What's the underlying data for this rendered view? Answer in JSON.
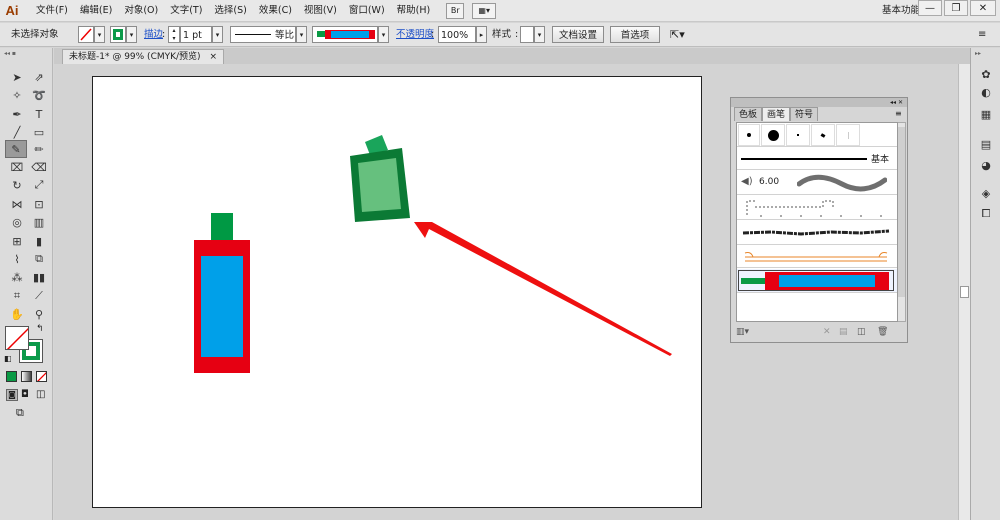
{
  "app": {
    "logo": "Ai"
  },
  "menu": [
    "文件(F)",
    "编辑(E)",
    "对象(O)",
    "文字(T)",
    "选择(S)",
    "效果(C)",
    "视图(V)",
    "窗口(W)",
    "帮助(H)"
  ],
  "menu_icons": {
    "bridge": "Br",
    "arrange": "▦▾"
  },
  "workspace": {
    "label": "基本功能",
    "dropdown": "▾"
  },
  "window_controls": {
    "minimize": "—",
    "restore": "❐",
    "close": "✕"
  },
  "controlbar": {
    "selection_label": "未选择对象",
    "stroke_label": "描边",
    "stroke_weight": "1 pt",
    "stroke_profile": "等比",
    "opacity_label": "不透明度",
    "opacity_value": "100%",
    "style_label": "样式",
    "doc_setup": "文档设置",
    "preferences": "首选项"
  },
  "document": {
    "tab_title": "未标题-1* @ 99% (CMYK/预览)",
    "tab_close": "×"
  },
  "panel": {
    "header": "◂◂ ✕",
    "tabs": [
      "色板",
      "画笔",
      "符号"
    ],
    "active_tab": "画笔",
    "basic_label": "基本",
    "size_value": "6.00"
  },
  "colors": {
    "bottle_red": "#e60012",
    "bottle_blue": "#00a0e9",
    "bottle_cap": "#009944",
    "jar_dark": "#0b7a35",
    "jar_light": "#66c07e",
    "jar_cap": "#1aa55b",
    "arrow_red": "#ee1010"
  }
}
